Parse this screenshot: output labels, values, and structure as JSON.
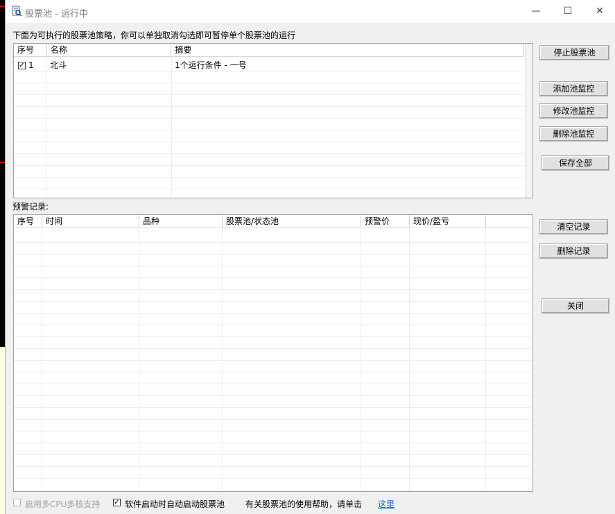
{
  "window": {
    "title": "股票池 - 运行中",
    "controls": {
      "minimize": "—",
      "maximize": "☐",
      "close": "✕"
    }
  },
  "strategy_section": {
    "description": "下面为可执行的股票池策略，你可以单独取消勾选即可暂停单个股票池的运行",
    "columns": [
      "序号",
      "名称",
      "摘要"
    ],
    "rows": [
      {
        "checked": true,
        "index": "1",
        "name": "北斗",
        "summary": "1个运行条件 - 一号"
      }
    ]
  },
  "alert_section": {
    "label": "预警记录:",
    "columns": [
      "序号",
      "时间",
      "品种",
      "股票池/状态池",
      "预警价",
      "现价/盈亏"
    ],
    "rows": []
  },
  "buttons": {
    "stop": "停止股票池",
    "add_monitor": "添加池监控",
    "edit_monitor": "修改池监控",
    "delete_monitor": "删除池监控",
    "save_all": "保存全部",
    "clear_records": "清空记录",
    "delete_records": "删除记录",
    "close": "关闭"
  },
  "footer": {
    "multi_cpu": {
      "label": "启用多CPU多核支持",
      "checked": false,
      "enabled": false
    },
    "autostart": {
      "label": "软件启动时自动启动股票池",
      "checked": true
    },
    "help_text": "有关股票池的使用帮助，请单击",
    "help_link": "这里"
  }
}
